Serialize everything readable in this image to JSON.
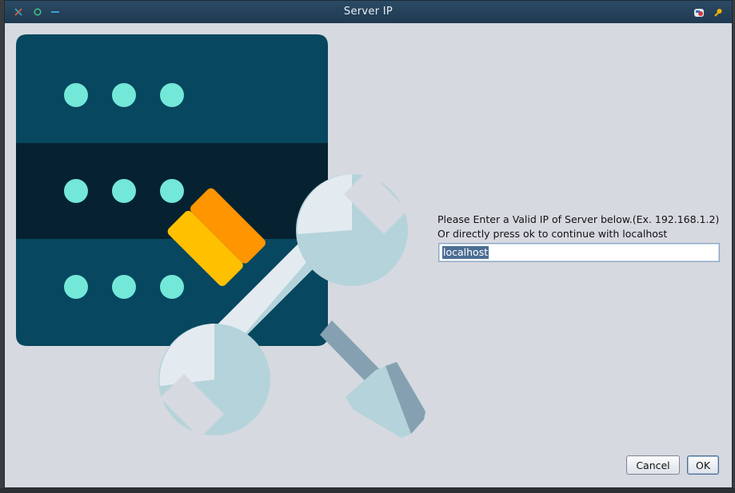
{
  "window": {
    "title": "Server IP",
    "controls": {
      "close": "close-icon",
      "maximize": "maximize-icon",
      "minimize": "minimize-icon"
    },
    "tray_icons": [
      "app-badge-icon",
      "key-icon"
    ]
  },
  "illustration": {
    "name": "server-tools-illustration",
    "colors": {
      "rack_top": "#07475f",
      "rack_mid": "#062230",
      "rack_bottom": "#07475f",
      "led": "#73e8d8",
      "wrench_light": "#e3ebf1",
      "wrench_shadow": "#b5d3da",
      "screwdriver_shaft": "#85a1b1",
      "handle_orange": "#ff9500",
      "handle_yellow": "#ffc000"
    }
  },
  "dialog": {
    "message_line1": "Please Enter a Valid IP of Server below.(Ex. 192.168.1.2)",
    "message_line2": "Or directly press ok to continue with localhost",
    "ip_field": {
      "value": "localhost",
      "placeholder": ""
    }
  },
  "buttons": {
    "cancel_label": "Cancel",
    "ok_label": "OK"
  }
}
